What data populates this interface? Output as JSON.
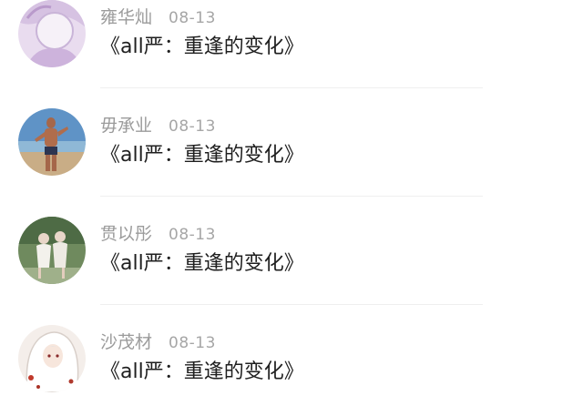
{
  "comments": [
    {
      "username": "雍华灿",
      "date": "08-13",
      "text": "《all严：重逢的变化》",
      "avatar_icon": "anime-girl-lavender-avatar"
    },
    {
      "username": "毋承业",
      "date": "08-13",
      "text": "《all严：重逢的变化》",
      "avatar_icon": "beach-runner-avatar"
    },
    {
      "username": "贯以彤",
      "date": "08-13",
      "text": "《all严：重逢的变化》",
      "avatar_icon": "two-girls-garden-avatar"
    },
    {
      "username": "沙茂材",
      "date": "08-13",
      "text": "《all严：重逢的变化》",
      "avatar_icon": "white-hair-anime-avatar"
    }
  ]
}
